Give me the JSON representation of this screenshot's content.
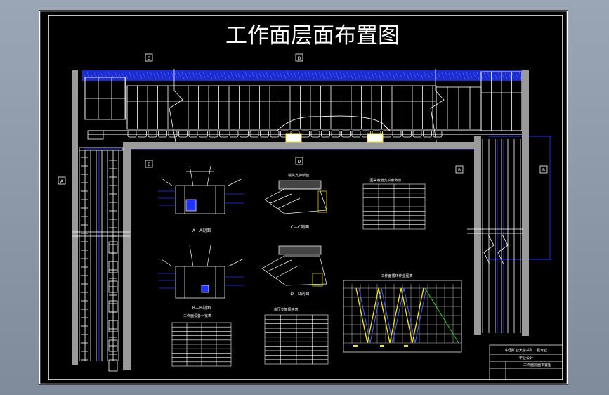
{
  "title": "工作面层面布置图",
  "section_markers": [
    "C",
    "D",
    "A",
    "B",
    "E",
    "D",
    "B"
  ],
  "view_labels": {
    "aa": "A—A剖面",
    "bb": "B—B剖面",
    "cc": "C—C剖面",
    "dd": "D—D剖面",
    "top_center": "端头支护断面"
  },
  "table_titles": {
    "left": "工作面设备一览表",
    "middle": "液压支架规格表",
    "right": "回采巷道支护参数表"
  },
  "schedule_title": "工作面循环作业图表",
  "title_block": {
    "line1": "中国矿业大学采矿工程专业",
    "line2": "毕业设计",
    "line3": "工作面层面布置图"
  },
  "colors": {
    "background": "#000000",
    "frame": "#ffffff",
    "accent_blue": "#2233ff",
    "gob_blue": "#1a2bd0",
    "gray_wall": "#9a9a9a",
    "yellow": "#ffe600",
    "green": "#22dd22"
  }
}
